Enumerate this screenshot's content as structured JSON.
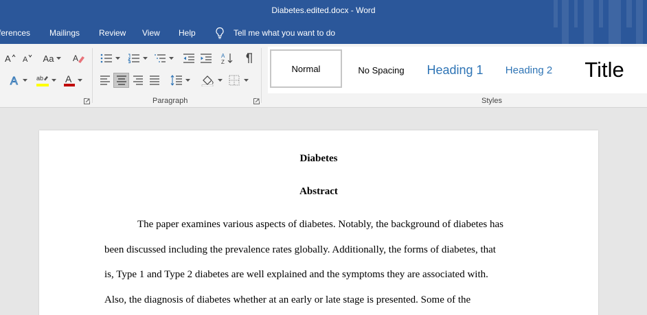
{
  "window": {
    "title": "Diabetes.edited.docx  -  Word"
  },
  "menu": {
    "tabs": [
      "ferences",
      "Mailings",
      "Review",
      "View",
      "Help"
    ],
    "tell_me": "Tell me what you want to do"
  },
  "ribbon": {
    "font_case_label": "Aa",
    "paragraph_label": "Paragraph",
    "styles_label": "Styles",
    "styles": [
      "Normal",
      "No Spacing",
      "Heading 1",
      "Heading 2",
      "Title"
    ]
  },
  "document": {
    "title": "Diabetes",
    "abstract_heading": "Abstract",
    "lines": [
      "The paper examines various aspects of diabetes. Notably, the background of diabetes has",
      "been discussed including the prevalence rates globally. Additionally, the forms of diabetes, that",
      "is, Type 1 and Type 2 diabetes are well explained and the symptoms they are associated with.",
      "Also, the diagnosis of diabetes whether at an early or late stage is presented. Some of the"
    ]
  },
  "colors": {
    "titlebar": "#2b579a",
    "ribbon": "#f3f3f3",
    "heading_blue": "#2e74b5",
    "highlight_yellow": "#ffff00",
    "font_red": "#c00000"
  }
}
